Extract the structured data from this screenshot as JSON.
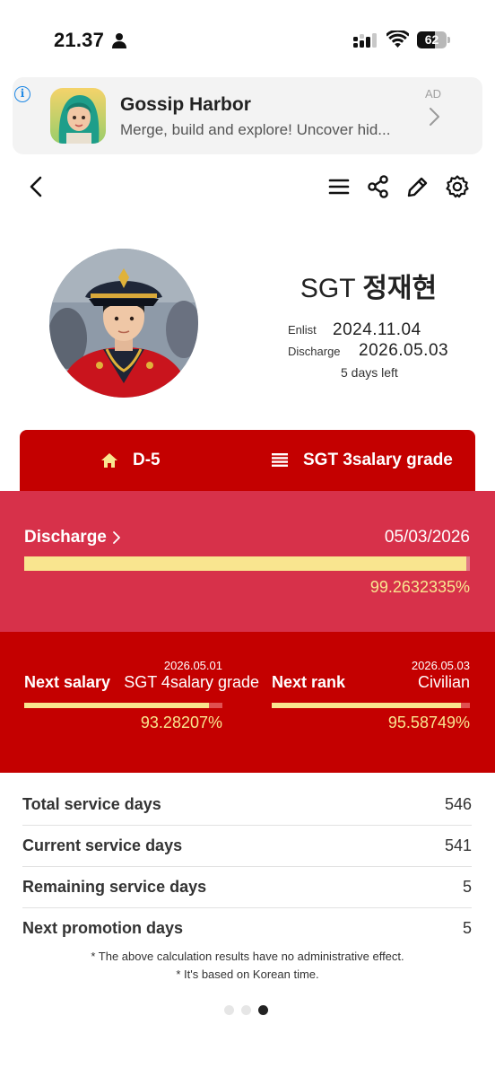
{
  "status_bar": {
    "time": "21.37",
    "battery_level": "62"
  },
  "ad": {
    "info_icon": "info-icon",
    "title": "Gossip Harbor",
    "description": "Merge, build and explore! Uncover hid...",
    "label": "AD"
  },
  "toolbar": {
    "icons": [
      "back-icon",
      "menu-icon",
      "share-icon",
      "edit-icon",
      "settings-icon"
    ]
  },
  "profile": {
    "rank": "SGT",
    "name": "정재현",
    "enlist_label": "Enlist",
    "enlist_date": "2024.11.04",
    "discharge_label": "Discharge",
    "discharge_date": "2026.05.03",
    "days_left": "5 days left"
  },
  "tabs": [
    {
      "icon": "home-icon",
      "label": "D-5"
    },
    {
      "icon": "list-icon",
      "label": "SGT 3salary grade"
    }
  ],
  "discharge": {
    "label": "Discharge",
    "date": "05/03/2026",
    "progress_percent": 99.2632335,
    "progress_text": "99.2632335%"
  },
  "next_salary": {
    "label": "Next salary",
    "date": "2026.05.01",
    "value": "SGT 4salary grade",
    "progress_percent": 93.28207,
    "progress_text": "93.28207%"
  },
  "next_rank": {
    "label": "Next rank",
    "date": "2026.05.03",
    "value": "Civilian",
    "progress_percent": 95.58749,
    "progress_text": "95.58749%"
  },
  "stats": [
    {
      "label": "Total service days",
      "value": "546"
    },
    {
      "label": "Current service days",
      "value": "541"
    },
    {
      "label": "Remaining service days",
      "value": "5"
    },
    {
      "label": "Next promotion days",
      "value": "5"
    }
  ],
  "notes": [
    "* The above calculation results have no administrative effect.",
    "* It's based on Korean time."
  ],
  "pagination": {
    "total": 3,
    "active": 3
  },
  "colors": {
    "accent_red": "#c40000",
    "panel_pink": "#d7314a",
    "progress_yellow": "#f9e58f",
    "ad_blue": "#1e88e5"
  }
}
